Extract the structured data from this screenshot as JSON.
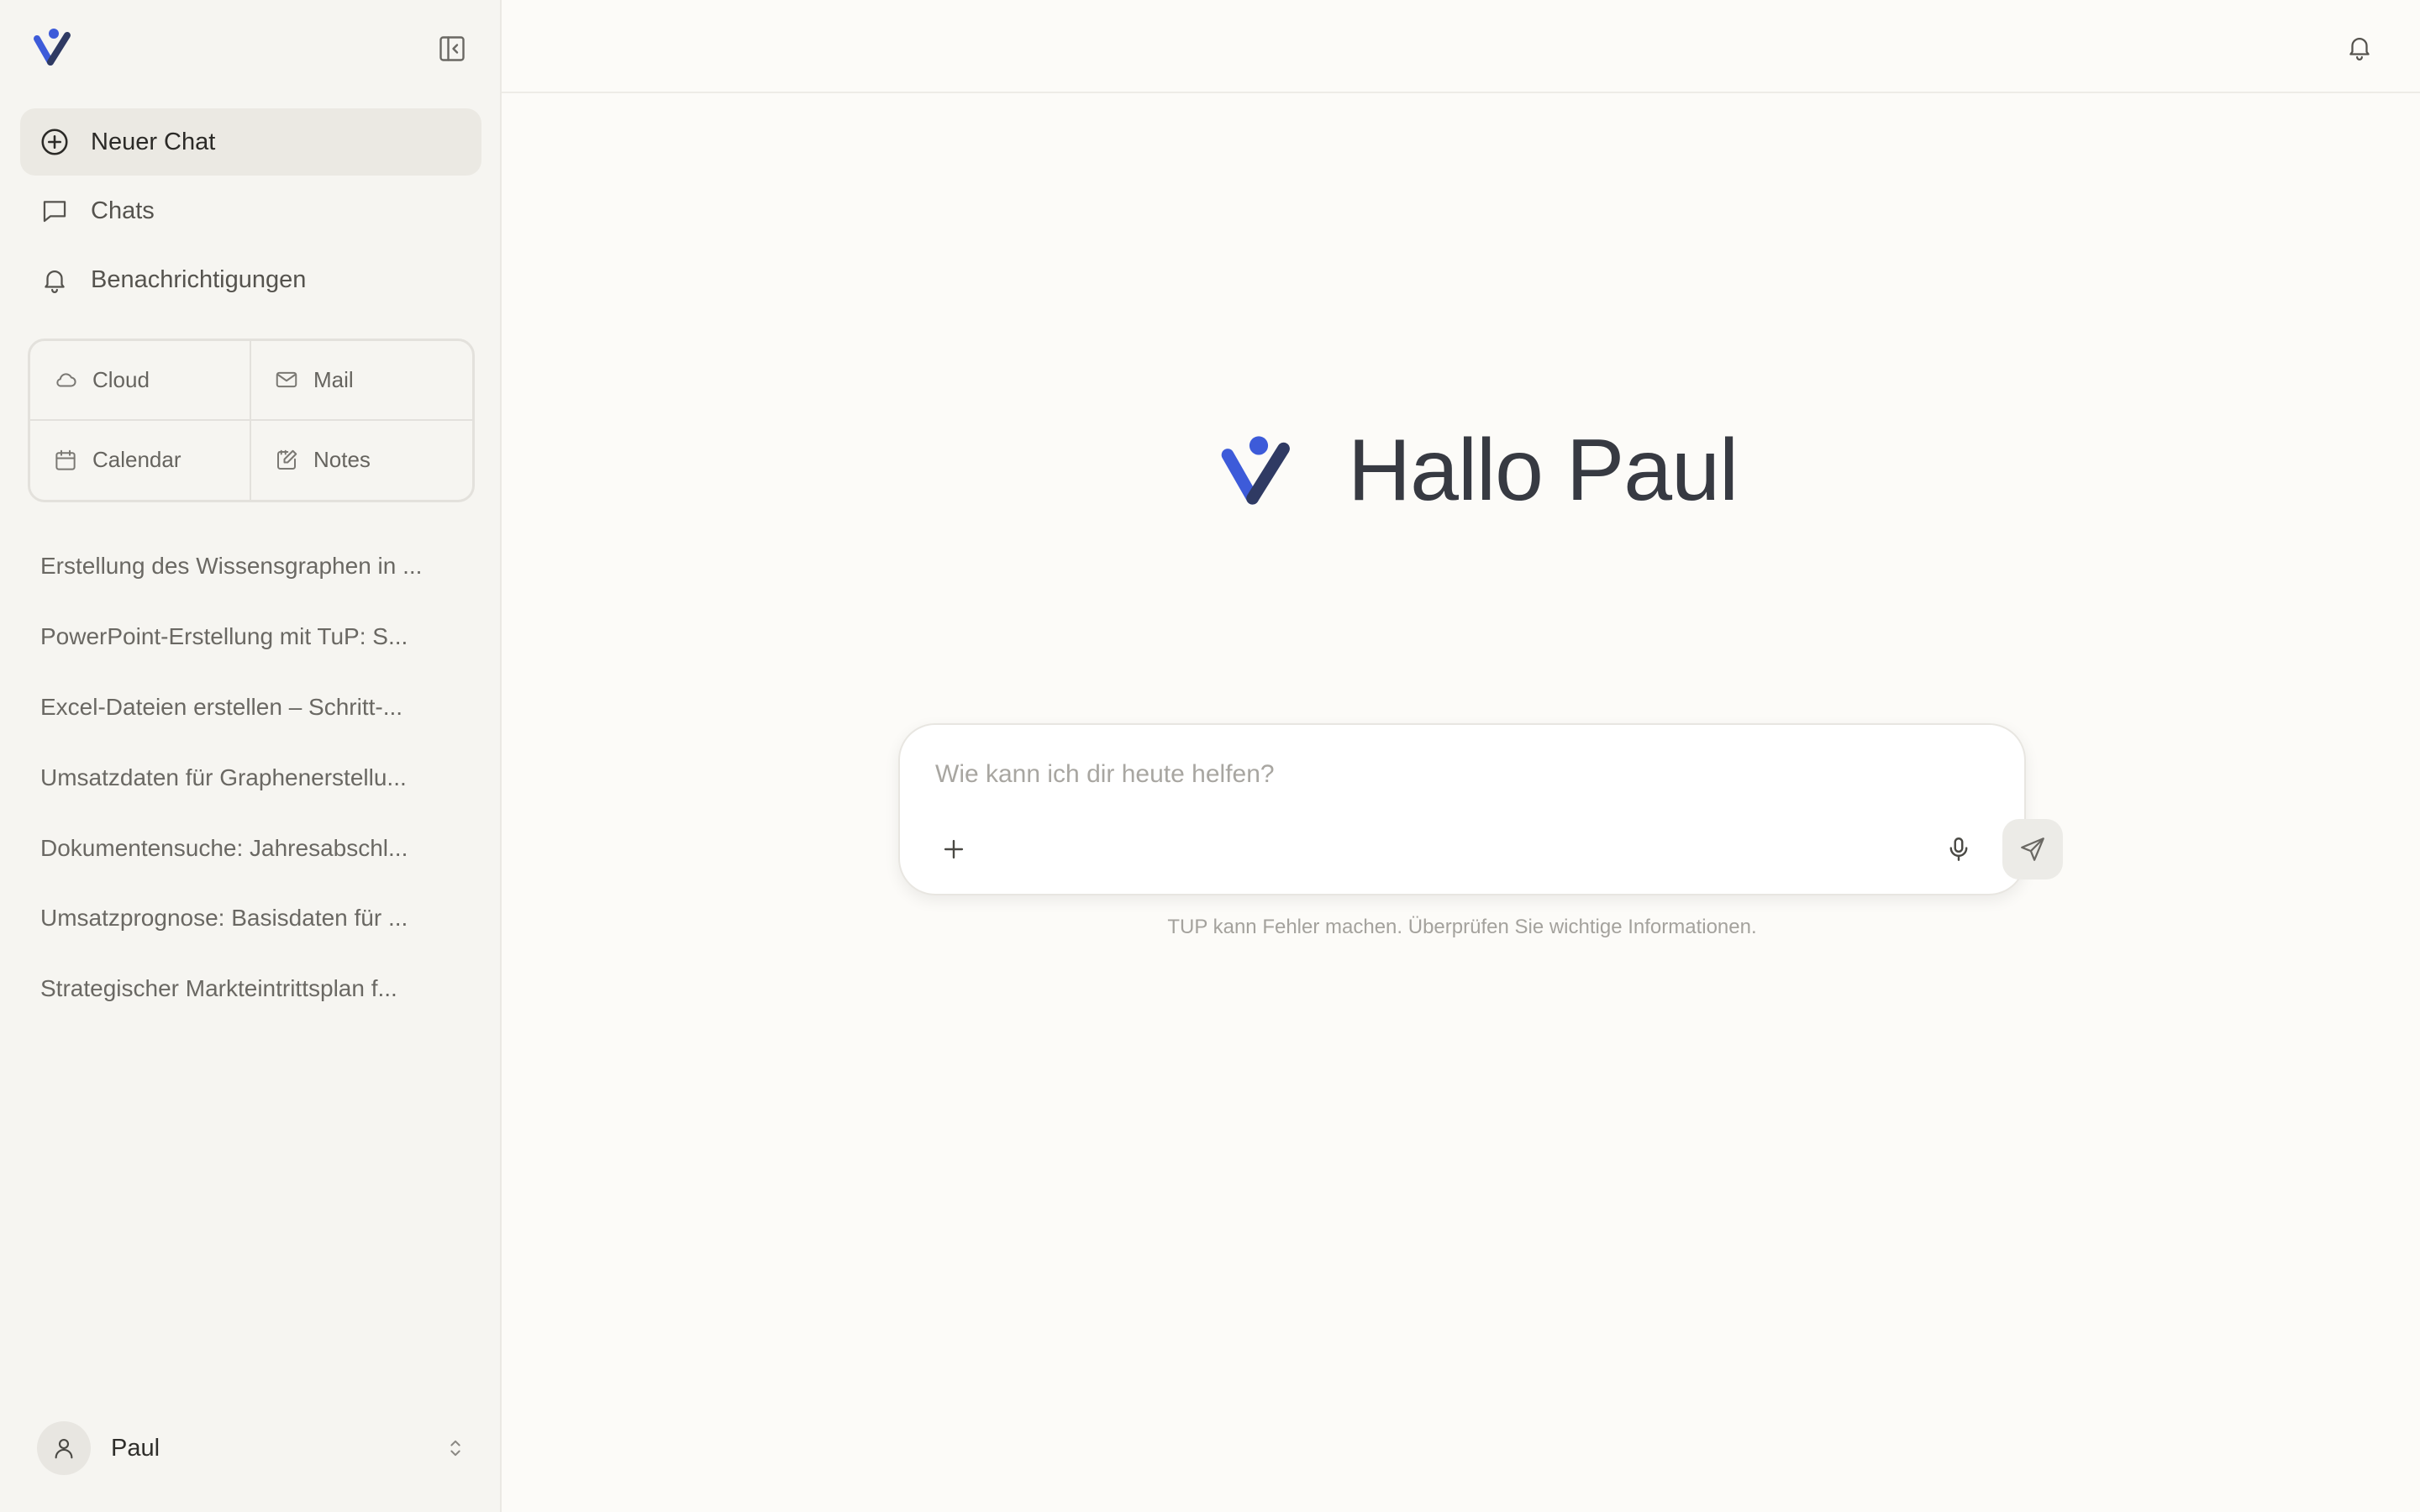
{
  "sidebar": {
    "nav": [
      {
        "label": "Neuer Chat",
        "icon": "plus-circle-icon"
      },
      {
        "label": "Chats",
        "icon": "chat-bubble-icon"
      },
      {
        "label": "Benachrichtigungen",
        "icon": "bell-icon"
      }
    ],
    "apps": [
      {
        "label": "Cloud",
        "icon": "cloud-icon"
      },
      {
        "label": "Mail",
        "icon": "mail-icon"
      },
      {
        "label": "Calendar",
        "icon": "calendar-icon"
      },
      {
        "label": "Notes",
        "icon": "notes-icon"
      }
    ],
    "history": [
      "Erstellung des Wissensgraphen in ...",
      "PowerPoint-Erstellung mit TuP: S...",
      "Excel-Dateien erstellen – Schritt-...",
      "Umsatzdaten für Graphenerstellu...",
      "Dokumentensuche: Jahresabschl...",
      "Umsatzprognose: Basisdaten für ...",
      "Strategischer Markteintrittsplan f..."
    ],
    "user": {
      "name": "Paul"
    }
  },
  "main": {
    "greeting": "Hallo Paul",
    "composer": {
      "placeholder": "Wie kann ich dir heute helfen?",
      "value": ""
    },
    "disclaimer": "TUP kann Fehler machen. Überprüfen Sie wichtige Informationen."
  },
  "colors": {
    "brand_blue": "#3d5bd9",
    "brand_navy": "#2f3a63",
    "background": "#fcfbf8",
    "sidebar_bg": "#f6f5f1"
  }
}
